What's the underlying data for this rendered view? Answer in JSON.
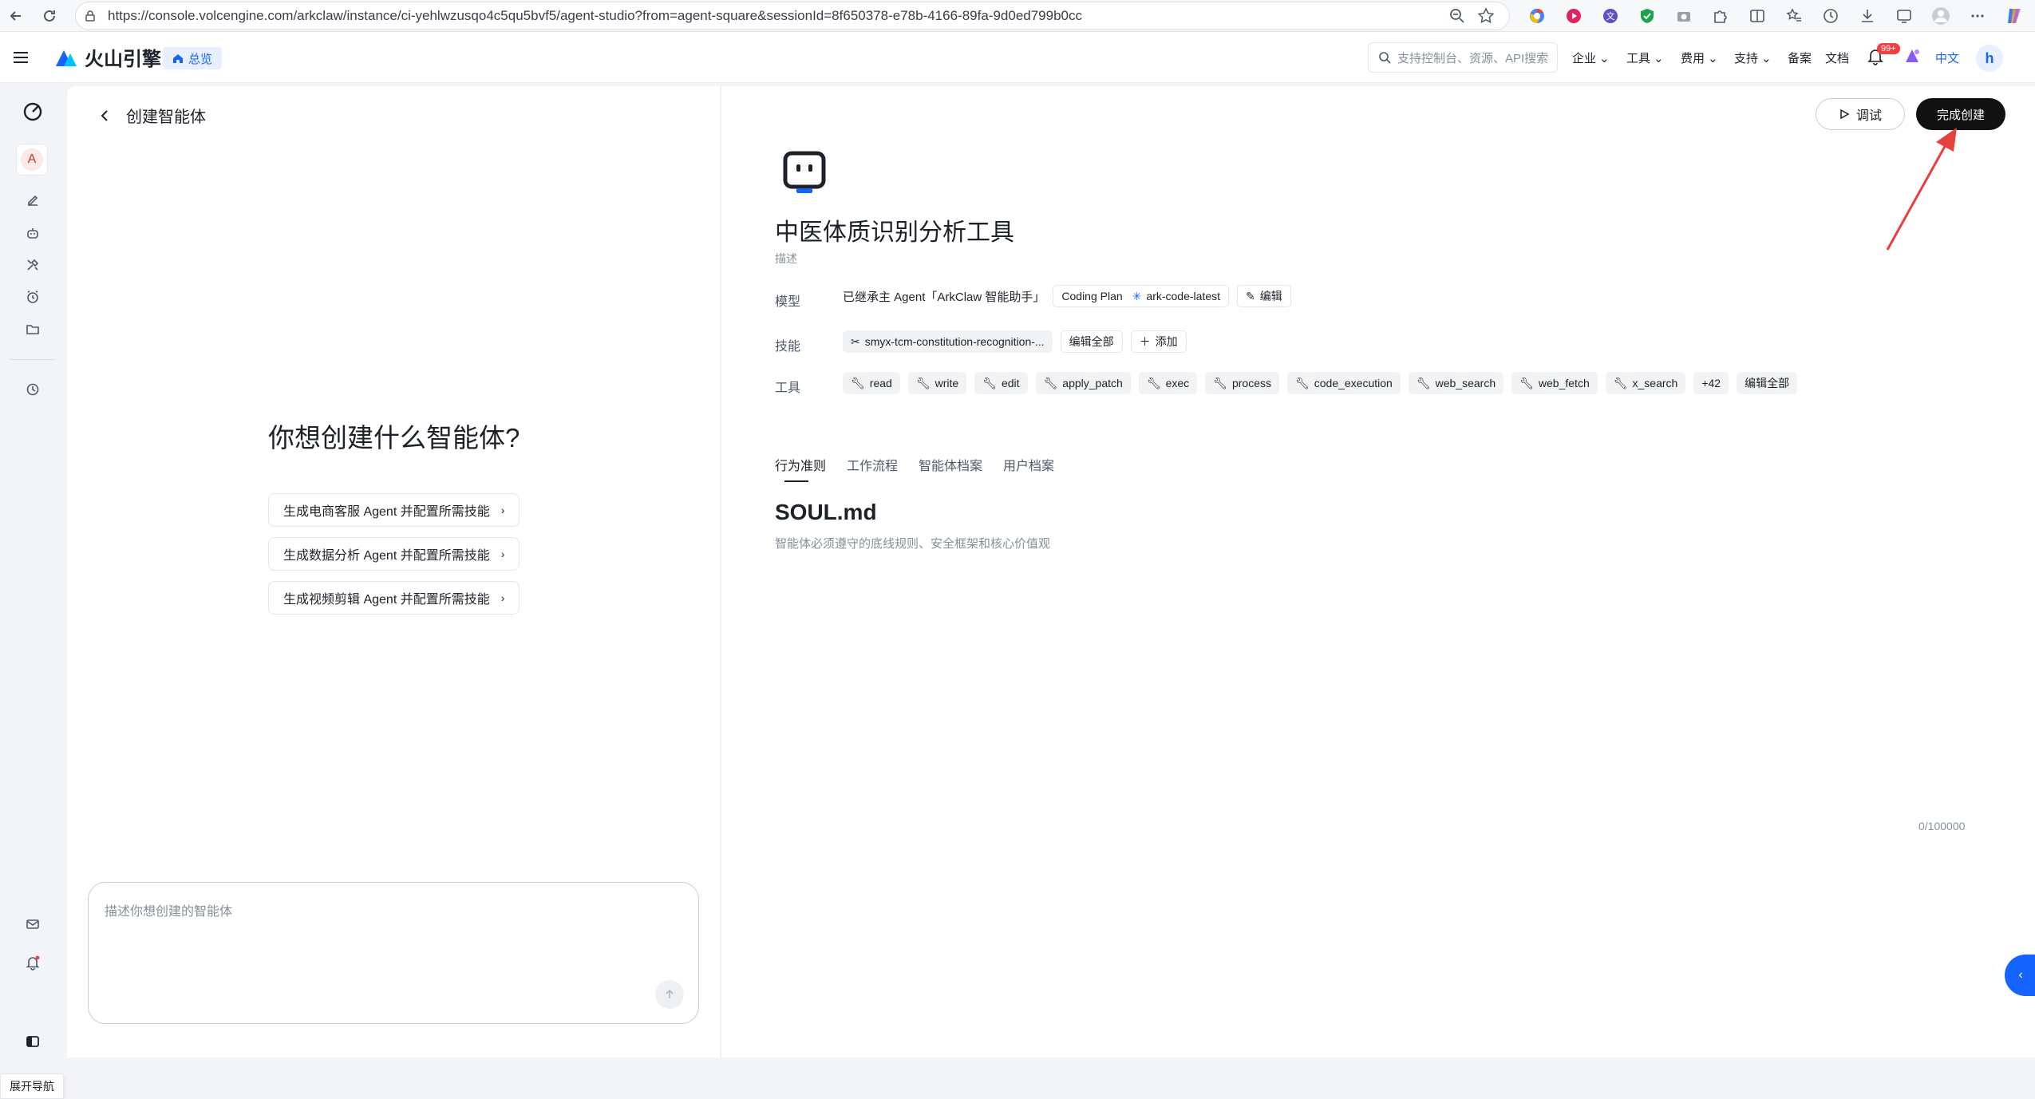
{
  "browser": {
    "url": "https://console.volcengine.com/arkclaw/instance/ci-yehlwzusqo4c5qu5bvf5/agent-studio?from=agent-square&sessionId=8f650378-e78b-4166-89fa-9d0ed799b0cc"
  },
  "header": {
    "brand": "火山引擎",
    "overview": "总览",
    "search_placeholder": "支持控制台、资源、API搜索",
    "nav": [
      "企业",
      "工具",
      "费用",
      "支持",
      "备案",
      "文档"
    ],
    "bell_badge": "99+",
    "lang": "中文",
    "avatar": "h"
  },
  "rail": {
    "avatar_letter": "A",
    "tooltip": "展开导航"
  },
  "left": {
    "back_title": "创建智能体",
    "prompt_title": "你想创建什么智能体?",
    "suggestions": [
      "生成电商客服 Agent 并配置所需技能",
      "生成数据分析 Agent 并配置所需技能",
      "生成视频剪辑 Agent 并配置所需技能"
    ],
    "composer_placeholder": "描述你想创建的智能体"
  },
  "right": {
    "debug": "调试",
    "finish": "完成创建",
    "agent_name": "中医体质识别分析工具",
    "description": "描述",
    "model_label": "模型",
    "model_inherit": "已继承主 Agent「ArkClaw 智能助手」",
    "model_plan": "Coding Plan",
    "model_name": "ark-code-latest",
    "model_edit": "编辑",
    "skills_label": "技能",
    "skill_name": "smyx-tcm-constitution-recognition-...",
    "skill_edit_all": "编辑全部",
    "skill_add": "添加",
    "tools_label": "工具",
    "tools": [
      "read",
      "write",
      "edit",
      "apply_patch",
      "exec",
      "process",
      "code_execution",
      "web_search",
      "web_fetch",
      "x_search"
    ],
    "tools_more": "+42",
    "tools_edit_all": "编辑全部",
    "tabs": [
      "行为准则",
      "工作流程",
      "智能体档案",
      "用户档案"
    ],
    "doc_title": "SOUL.md",
    "doc_desc": "智能体必须遵守的底线规则、安全框架和核心价值观",
    "counter": "0/100000"
  },
  "colors": {
    "accent": "#1664ff",
    "annotation": "#e8413c",
    "finish_button": "#111111"
  }
}
